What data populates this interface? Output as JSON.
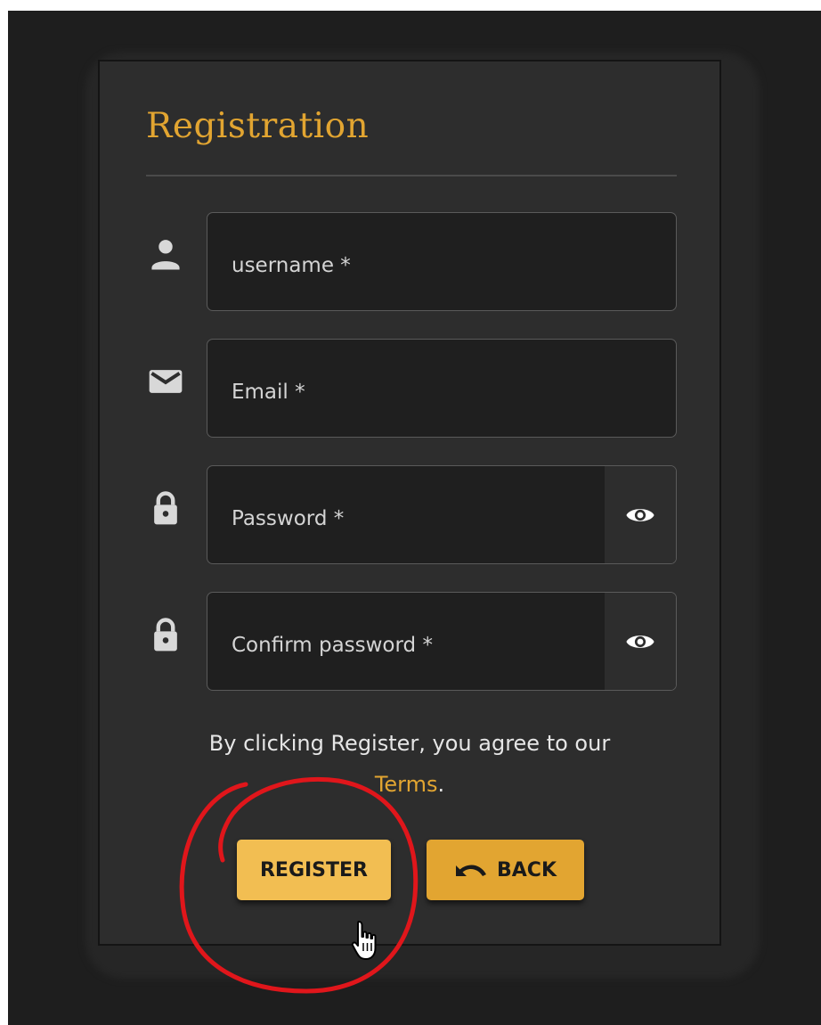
{
  "form": {
    "title": "Registration",
    "fields": [
      {
        "name": "username",
        "placeholder": "username *",
        "value": "",
        "icon": "person-icon"
      },
      {
        "name": "email",
        "placeholder": "Email *",
        "value": "",
        "icon": "mail-icon"
      },
      {
        "name": "password",
        "placeholder": "Password *",
        "value": "",
        "icon": "lock-icon",
        "toggle_icon": "eye-icon"
      },
      {
        "name": "confirm_password",
        "placeholder": "Confirm password *",
        "value": "",
        "icon": "lock-icon",
        "toggle_icon": "eye-icon"
      }
    ],
    "terms": {
      "text": "By clicking Register, you agree to our",
      "link_label": "Terms",
      "suffix": "."
    },
    "buttons": {
      "register_label": "REGISTER",
      "back_label": "BACK",
      "back_icon": "undo-icon"
    }
  },
  "colors": {
    "accent": "#e2a531",
    "register_button": "#f2be52",
    "back_button": "#e2a531",
    "card_background": "#2d2d2d",
    "page_background": "#1e1e1e",
    "annotation": "#e0161b"
  }
}
